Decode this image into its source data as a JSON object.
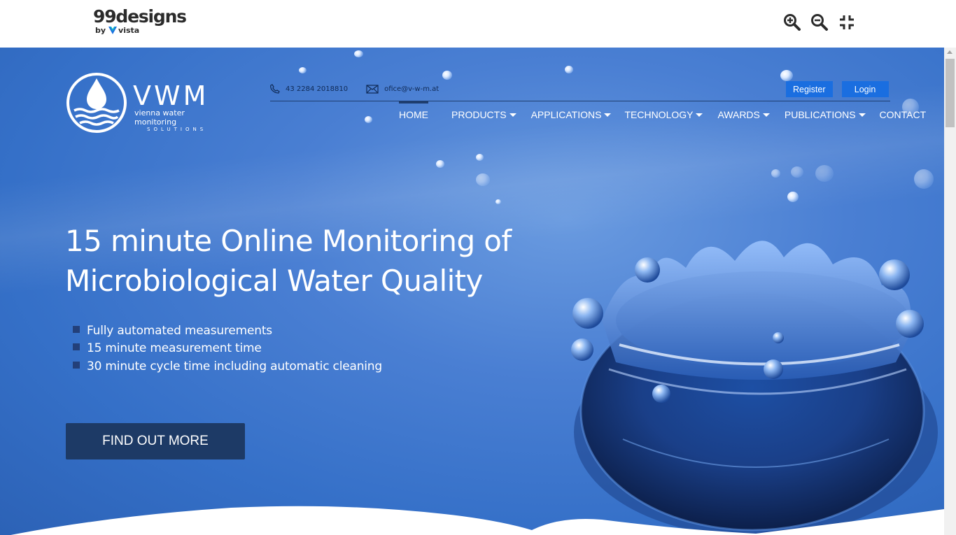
{
  "viewer": {
    "brand_name": "99designs",
    "brand_by": "by",
    "brand_partner": "vista",
    "tools": [
      {
        "icon": "zoom-in-icon"
      },
      {
        "icon": "zoom-out-icon"
      },
      {
        "icon": "exit-fullscreen-icon"
      }
    ]
  },
  "site": {
    "logo": {
      "mark": "VWM",
      "tagline": "vienna water monitoring",
      "subtag": "SOLUTIONS"
    },
    "contact": {
      "phone": "43 2284 2018810",
      "email": "ofice@v-w-m.at"
    },
    "auth": {
      "register": "Register",
      "login": "Login"
    },
    "nav": [
      {
        "label": "HOME",
        "active": true,
        "dropdown": false
      },
      {
        "label": "PRODUCTS",
        "dropdown": true
      },
      {
        "label": "APPLICATIONS",
        "dropdown": true
      },
      {
        "label": "TECHNOLOGY",
        "dropdown": true
      },
      {
        "label": "AWARDS",
        "dropdown": true
      },
      {
        "label": "PUBLICATIONS",
        "dropdown": true
      },
      {
        "label": "CONTACT",
        "dropdown": false
      }
    ],
    "hero": {
      "title_line1": "15 minute Online Monitoring of",
      "title_line2": "Microbiological Water Quality",
      "features": [
        "Fully automated measurements",
        "15 minute measurement time",
        "30 minute cycle time including automatic cleaning"
      ],
      "cta": "FIND OUT MORE"
    },
    "colors": {
      "primary_blue": "#3570c8",
      "button_blue": "#1a6ee0",
      "cta_navy": "#1d3a66"
    }
  }
}
